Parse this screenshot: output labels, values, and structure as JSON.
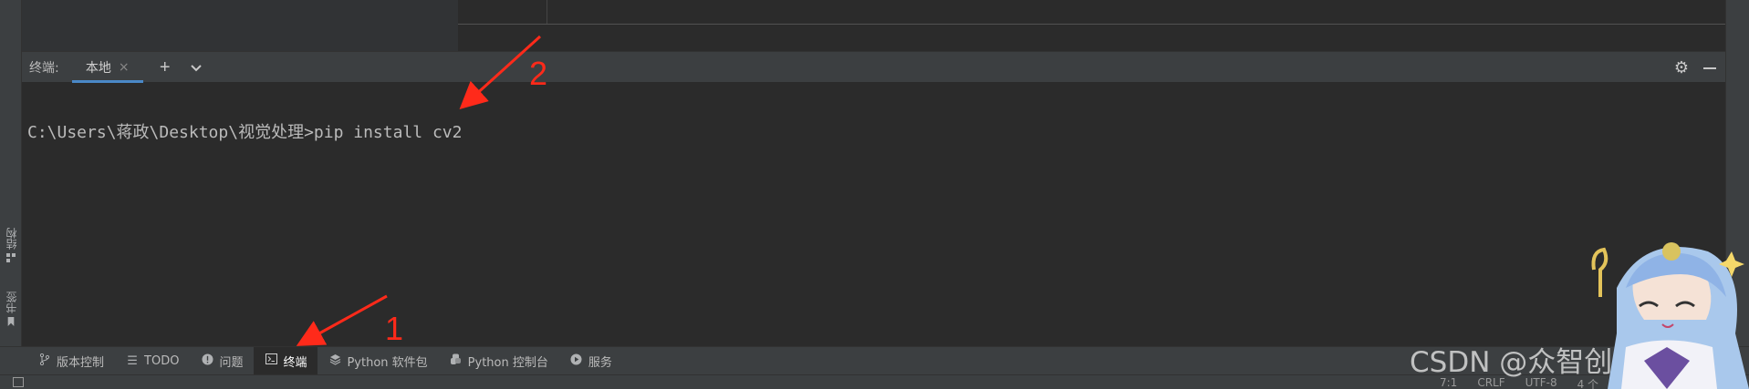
{
  "terminal": {
    "title": "终端:",
    "tab_local": "本地",
    "tab_close": "×",
    "add": "+",
    "dropdown": "⌄",
    "command_line": "C:\\Users\\蒋政\\Desktop\\视觉处理>pip install cv2"
  },
  "sidebar_left": {
    "structure_label": "结构",
    "bookmarks_label": "书签"
  },
  "annotations": {
    "label_1": "1",
    "label_2": "2",
    "color": "#ff2a1a"
  },
  "toolbar": {
    "items": [
      {
        "label": "版本控制",
        "icon": "branch-icon"
      },
      {
        "label": "TODO",
        "icon": "list-icon"
      },
      {
        "label": "问题",
        "icon": "alert-icon"
      },
      {
        "label": "终端",
        "icon": "terminal-icon",
        "active": true
      },
      {
        "label": "Python 软件包",
        "icon": "layers-icon"
      },
      {
        "label": "Python 控制台",
        "icon": "python-icon"
      },
      {
        "label": "服务",
        "icon": "play-icon"
      }
    ]
  },
  "status": {
    "position": "7:1",
    "line_ending": "CRLF",
    "encoding": "UTF-8",
    "indent": "4 个"
  },
  "watermark": "CSDN @众智创新团队",
  "colors": {
    "accent_tab": "#4a88c7",
    "background": "#2b2b2b",
    "panel": "#3c3f41"
  }
}
